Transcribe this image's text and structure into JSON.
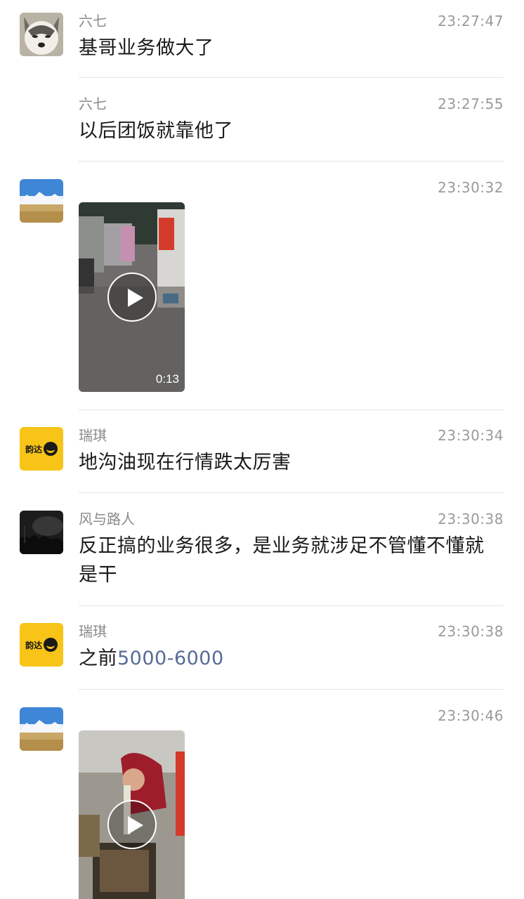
{
  "messages": [
    {
      "sender": "六七",
      "time": "23:27:47",
      "text": "基哥业务做大了",
      "avatar": "husky-avatar"
    },
    {
      "sender": "六七",
      "time": "23:27:55",
      "text": "以后团饭就靠他了"
    },
    {
      "sender": "",
      "time": "23:30:32",
      "video_duration": "0:13",
      "avatar": "landscape-avatar"
    },
    {
      "sender": "瑞琪",
      "time": "23:30:34",
      "text": "地沟油现在行情跌太厉害",
      "avatar": "yunda-logo-avatar"
    },
    {
      "sender": "风与路人",
      "time": "23:30:38",
      "text_line1": "反正搞的业务很多，是业务就涉足不管懂不懂就",
      "text_line2": "是干",
      "avatar": "dark-crowd-avatar"
    },
    {
      "sender": "瑞琪",
      "time": "23:30:38",
      "text_prefix": "之前",
      "text_link": "5000-6000",
      "avatar": "yunda-logo-avatar"
    },
    {
      "sender": "",
      "time": "23:30:46",
      "avatar": "landscape-avatar"
    }
  ],
  "yunda_logo": {
    "text": "韵达"
  },
  "colors": {
    "link": "#576b95",
    "yunda_yellow": "#f7c417",
    "divider": "#e5e5e5"
  }
}
